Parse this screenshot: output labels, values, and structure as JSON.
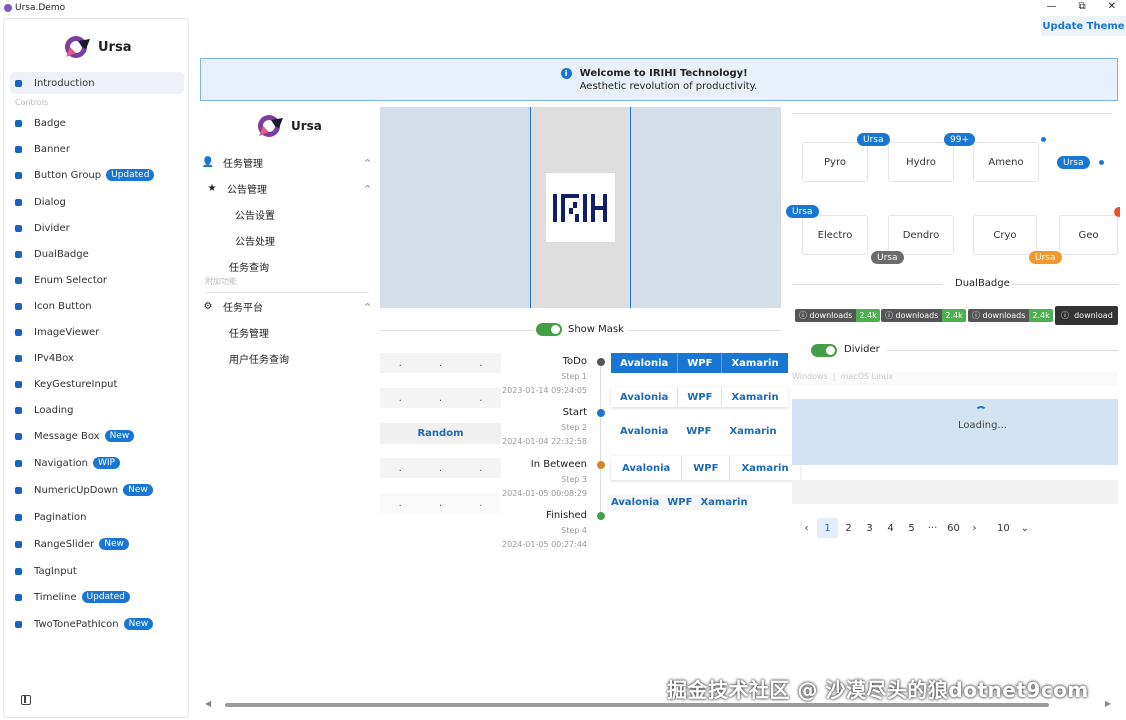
{
  "window": {
    "title": "Ursa.Demo",
    "controls": [
      "—",
      "⧉",
      "✕"
    ]
  },
  "header": {
    "update_theme": "Update Theme"
  },
  "sidebar": {
    "brand": "Ursa",
    "section_label": "Controls",
    "items": [
      {
        "label": "Introduction",
        "badge": ""
      },
      {
        "label": "Badge",
        "badge": ""
      },
      {
        "label": "Banner",
        "badge": ""
      },
      {
        "label": "Button Group",
        "badge": "Updated"
      },
      {
        "label": "Dialog",
        "badge": ""
      },
      {
        "label": "Divider",
        "badge": ""
      },
      {
        "label": "DualBadge",
        "badge": ""
      },
      {
        "label": "Enum Selector",
        "badge": ""
      },
      {
        "label": "Icon Button",
        "badge": ""
      },
      {
        "label": "ImageViewer",
        "badge": ""
      },
      {
        "label": "IPv4Box",
        "badge": ""
      },
      {
        "label": "KeyGestureInput",
        "badge": ""
      },
      {
        "label": "Loading",
        "badge": ""
      },
      {
        "label": "Message Box",
        "badge": "New"
      },
      {
        "label": "Navigation",
        "badge": "WIP"
      },
      {
        "label": "NumericUpDown",
        "badge": "New"
      },
      {
        "label": "Pagination",
        "badge": ""
      },
      {
        "label": "RangeSlider",
        "badge": "New"
      },
      {
        "label": "TagInput",
        "badge": ""
      },
      {
        "label": "Timeline",
        "badge": "Updated"
      },
      {
        "label": "TwoTonePathIcon",
        "badge": "New"
      }
    ]
  },
  "banner": {
    "title": "Welcome to IRIHI Technology!",
    "message": "Aesthetic revolution of productivity.",
    "icon": "info-icon"
  },
  "navmenu": {
    "brand": "Ursa",
    "items": [
      {
        "label": "任务管理",
        "icon": "person-icon",
        "arrow": "^"
      },
      {
        "label": "公告管理",
        "icon": "star-icon",
        "arrow": "^"
      },
      {
        "label": "公告设置"
      },
      {
        "label": "公告处理"
      },
      {
        "label": "任务查询"
      },
      {
        "label": "附加功能"
      },
      {
        "label": "任务平台",
        "icon": "gear-icon",
        "arrow": "^"
      },
      {
        "label": "任务管理"
      },
      {
        "label": "用户任务查询"
      }
    ]
  },
  "imageviewer": {
    "logo_text": "IRI"
  },
  "mask": {
    "label": "Show Mask",
    "on": true
  },
  "ipv4": {
    "separator": "."
  },
  "random_button": "Random",
  "timeline": [
    {
      "title": "ToDo",
      "step": "Step 1",
      "time": "2023-01-14 09:24:05",
      "color": "#555555"
    },
    {
      "title": "Start",
      "step": "Step 2",
      "time": "2024-01-04 22:32:58",
      "color": "#1976d2"
    },
    {
      "title": "In Between",
      "step": "Step 3",
      "time": "2024-01-05 00:08:29",
      "color": "#d9822b"
    },
    {
      "title": "Finished",
      "step": "Step 4",
      "time": "2024-01-05 00:27:44",
      "color": "#43a047"
    }
  ],
  "button_groups": {
    "labels": [
      "Avalonia",
      "WPF",
      "Xamarin"
    ]
  },
  "badges": {
    "cards_row1": [
      "Pyro",
      "Hydro",
      "Ameno"
    ],
    "cards_row2": [
      "Electro",
      "Dendro",
      "Cryo",
      "Geo"
    ],
    "badge_ursa": "Ursa",
    "badge_99": "99+",
    "colors": {
      "blue": "#1976d2",
      "gray": "#6b6b6b",
      "orange": "#ef9a2e"
    }
  },
  "dualbadge": {
    "title": "DualBadge",
    "left": "downloads",
    "right": "2.4k",
    "last_left": "download"
  },
  "divider": {
    "label": "Divider",
    "on": true
  },
  "enum": {
    "items": [
      "Windows",
      "macOS",
      "Linux"
    ]
  },
  "loading": {
    "text": "Loading..."
  },
  "pagination": {
    "prev": "‹",
    "pages": [
      "1",
      "2",
      "3",
      "4",
      "5",
      "···",
      "60"
    ],
    "next": "›",
    "page_size": "10",
    "active": "1"
  },
  "watermark": "掘金技术社区 @ 沙漠尽头的狼dotnet9com"
}
